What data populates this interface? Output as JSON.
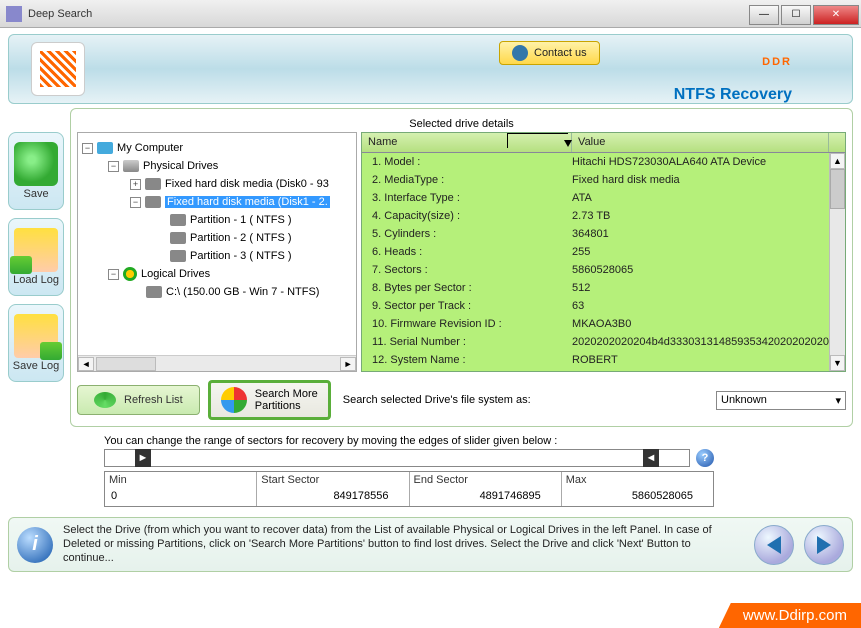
{
  "window": {
    "title": "Deep Search"
  },
  "header": {
    "contact_label": "Contact us",
    "brand": "DDR",
    "brand_sub": "NTFS Recovery"
  },
  "sidebar": {
    "save": "Save",
    "load_log": "Load Log",
    "save_log": "Save Log"
  },
  "selected_label": "Selected drive details",
  "tree": {
    "root": "My Computer",
    "physical": "Physical Drives",
    "disk0": "Fixed hard disk media (Disk0 - 93",
    "disk1": "Fixed hard disk media (Disk1 - 2.",
    "part1": "Partition - 1 ( NTFS )",
    "part2": "Partition - 2 ( NTFS )",
    "part3": "Partition - 3 ( NTFS )",
    "logical": "Logical Drives",
    "c_drive": "C:\\ (150.00 GB - Win 7 - NTFS)"
  },
  "details": {
    "col_name": "Name",
    "col_value": "Value",
    "rows": [
      {
        "n": "1. Model :",
        "v": "Hitachi HDS723030ALA640 ATA Device"
      },
      {
        "n": "2. MediaType :",
        "v": "Fixed hard disk media"
      },
      {
        "n": "3. Interface Type :",
        "v": "ATA"
      },
      {
        "n": "4. Capacity(size) :",
        "v": "2.73 TB"
      },
      {
        "n": "5. Cylinders :",
        "v": "364801"
      },
      {
        "n": "6. Heads :",
        "v": "255"
      },
      {
        "n": "7. Sectors :",
        "v": "5860528065"
      },
      {
        "n": "8. Bytes per Sector :",
        "v": "512"
      },
      {
        "n": "9. Sector per Track :",
        "v": "63"
      },
      {
        "n": "10. Firmware Revision ID :",
        "v": "MKAOA3B0"
      },
      {
        "n": "11. Serial Number :",
        "v": "2020202020204b4d33303131485935342020202020"
      },
      {
        "n": "12. System Name :",
        "v": "ROBERT"
      }
    ]
  },
  "toolbar": {
    "refresh": "Refresh List",
    "search_more": "Search More\nPartitions",
    "fs_label": "Search selected Drive's file system as:",
    "fs_value": "Unknown"
  },
  "slider": {
    "instruction": "You can change the range of sectors for recovery by moving the edges of slider given below :",
    "min_h": "Min",
    "min_v": "0",
    "start_h": "Start Sector",
    "start_v": "849178556",
    "end_h": "End Sector",
    "end_v": "4891746895",
    "max_h": "Max",
    "max_v": "5860528065"
  },
  "footer": {
    "text": "Select the Drive (from which you want to recover data) from the List of available Physical or Logical Drives in the left Panel. In case of Deleted or missing Partitions, click on 'Search More Partitions' button to find lost drives. Select the Drive and click 'Next' Button to continue..."
  },
  "watermark": "www.Ddirp.com"
}
